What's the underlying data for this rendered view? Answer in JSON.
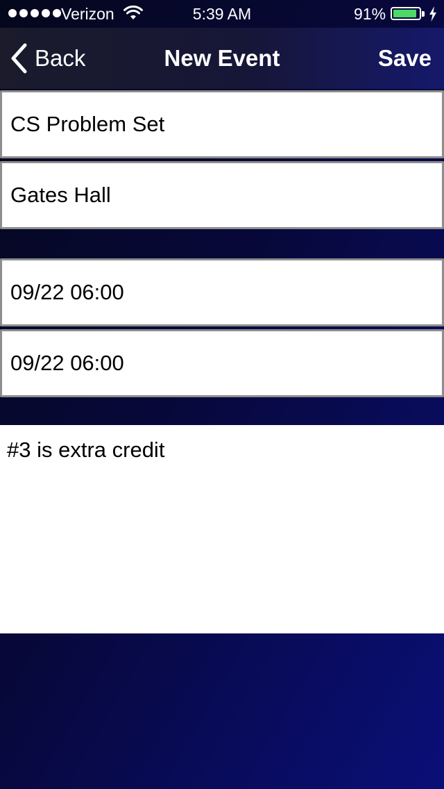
{
  "status_bar": {
    "carrier": "Verizon",
    "time": "5:39 AM",
    "battery_percent": "91%",
    "battery_level": 0.91,
    "signal_bars": 5,
    "icons": [
      "signal-dots-icon",
      "wifi-icon",
      "battery-icon",
      "charging-bolt-icon"
    ]
  },
  "nav": {
    "back_label": "Back",
    "title": "New Event",
    "save_label": "Save"
  },
  "form": {
    "title_value": "CS Problem Set",
    "location_value": "Gates Hall",
    "start_value": "09/22 06:00",
    "end_value": "09/22 06:00",
    "notes_value": "#3 is extra credit"
  },
  "colors": {
    "battery_fill": "#4cd964",
    "background_gradient_end": "#0a0f78",
    "field_border": "#8d8d8d"
  }
}
